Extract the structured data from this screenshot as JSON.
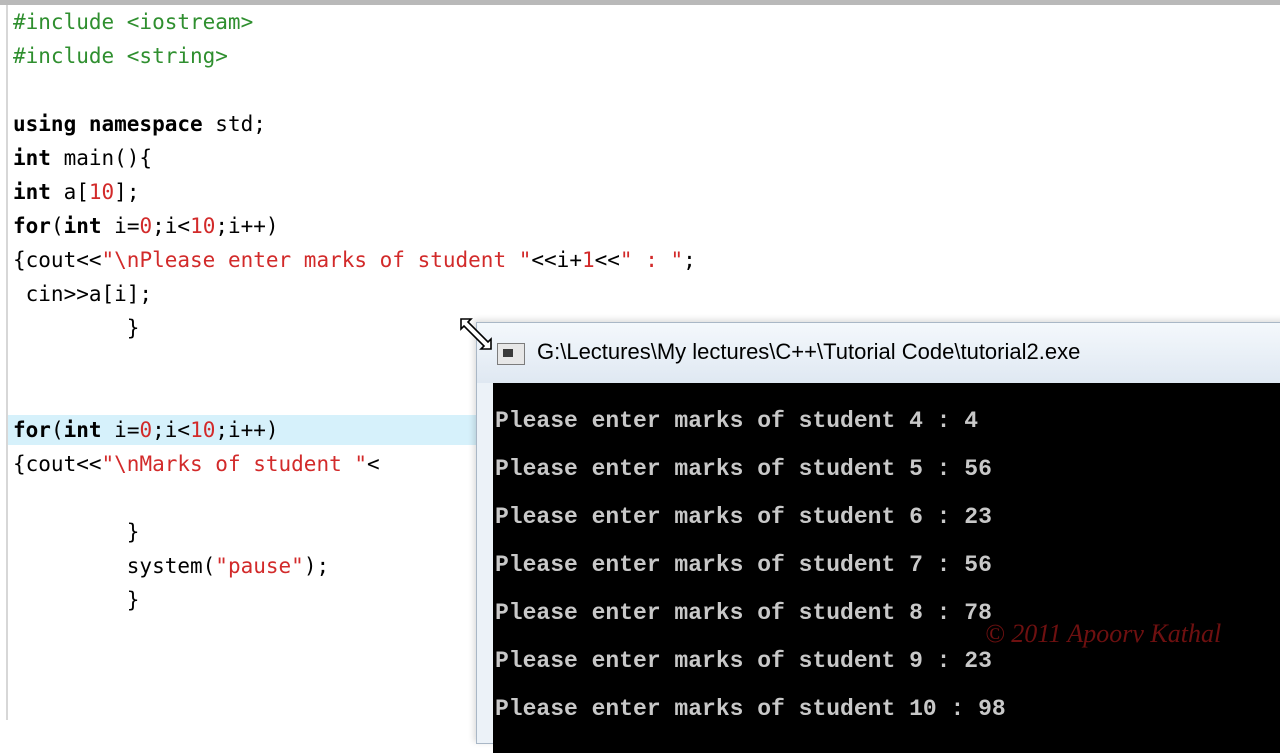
{
  "editor": {
    "lines": [
      {
        "parts": [
          {
            "c": "pp",
            "t": "#include <iostream>"
          }
        ]
      },
      {
        "parts": [
          {
            "c": "pp",
            "t": "#include <string>"
          }
        ]
      },
      {
        "parts": []
      },
      {
        "parts": [
          {
            "c": "kw",
            "t": "using namespace "
          },
          {
            "c": "pl",
            "t": "std;"
          }
        ]
      },
      {
        "parts": [
          {
            "c": "kw",
            "t": "int "
          },
          {
            "c": "pl",
            "t": "main(){"
          }
        ]
      },
      {
        "parts": [
          {
            "c": "kw",
            "t": "int "
          },
          {
            "c": "pl",
            "t": "a["
          },
          {
            "c": "num",
            "t": "10"
          },
          {
            "c": "pl",
            "t": "];"
          }
        ]
      },
      {
        "parts": [
          {
            "c": "kw",
            "t": "for"
          },
          {
            "c": "pl",
            "t": "("
          },
          {
            "c": "kw",
            "t": "int "
          },
          {
            "c": "pl",
            "t": "i="
          },
          {
            "c": "num",
            "t": "0"
          },
          {
            "c": "pl",
            "t": ";i<"
          },
          {
            "c": "num",
            "t": "10"
          },
          {
            "c": "pl",
            "t": ";i++)"
          }
        ]
      },
      {
        "parts": [
          {
            "c": "pl",
            "t": "{cout<<"
          },
          {
            "c": "str",
            "t": "\"\\nPlease enter marks of student \""
          },
          {
            "c": "pl",
            "t": "<<i+"
          },
          {
            "c": "num",
            "t": "1"
          },
          {
            "c": "pl",
            "t": "<<"
          },
          {
            "c": "str",
            "t": "\" : \""
          },
          {
            "c": "pl",
            "t": ";"
          }
        ]
      },
      {
        "parts": [
          {
            "c": "pl",
            "t": " cin>>a[i];"
          }
        ]
      },
      {
        "parts": [
          {
            "c": "pl",
            "t": "         }"
          }
        ]
      },
      {
        "parts": []
      },
      {
        "parts": []
      },
      {
        "parts": [
          {
            "c": "kw",
            "t": "for"
          },
          {
            "c": "pl",
            "t": "("
          },
          {
            "c": "kw",
            "t": "int "
          },
          {
            "c": "pl",
            "t": "i="
          },
          {
            "c": "num",
            "t": "0"
          },
          {
            "c": "pl",
            "t": ";i<"
          },
          {
            "c": "num",
            "t": "10"
          },
          {
            "c": "pl",
            "t": ";i++)"
          }
        ]
      },
      {
        "parts": [
          {
            "c": "pl",
            "t": "{cout<<"
          },
          {
            "c": "str",
            "t": "\"\\nMarks of student \""
          },
          {
            "c": "pl",
            "t": "<"
          }
        ]
      },
      {
        "parts": []
      },
      {
        "parts": [
          {
            "c": "pl",
            "t": "         }"
          }
        ]
      },
      {
        "parts": [
          {
            "c": "pl",
            "t": "         system("
          },
          {
            "c": "str",
            "t": "\"pause\""
          },
          {
            "c": "pl",
            "t": ");"
          }
        ]
      },
      {
        "parts": [
          {
            "c": "pl",
            "t": "         }"
          }
        ]
      }
    ]
  },
  "console": {
    "title": "G:\\Lectures\\My lectures\\C++\\Tutorial Code\\tutorial2.exe",
    "lines": [
      "Please enter marks of student 4 : 4",
      "Please enter marks of student 5 : 56",
      "Please enter marks of student 6 : 23",
      "Please enter marks of student 7 : 56",
      "Please enter marks of student 8 : 78",
      "Please enter marks of student 9 : 23",
      "Please enter marks of student 10 : 98"
    ],
    "watermark": "© 2011 Apoorv Kathal"
  }
}
